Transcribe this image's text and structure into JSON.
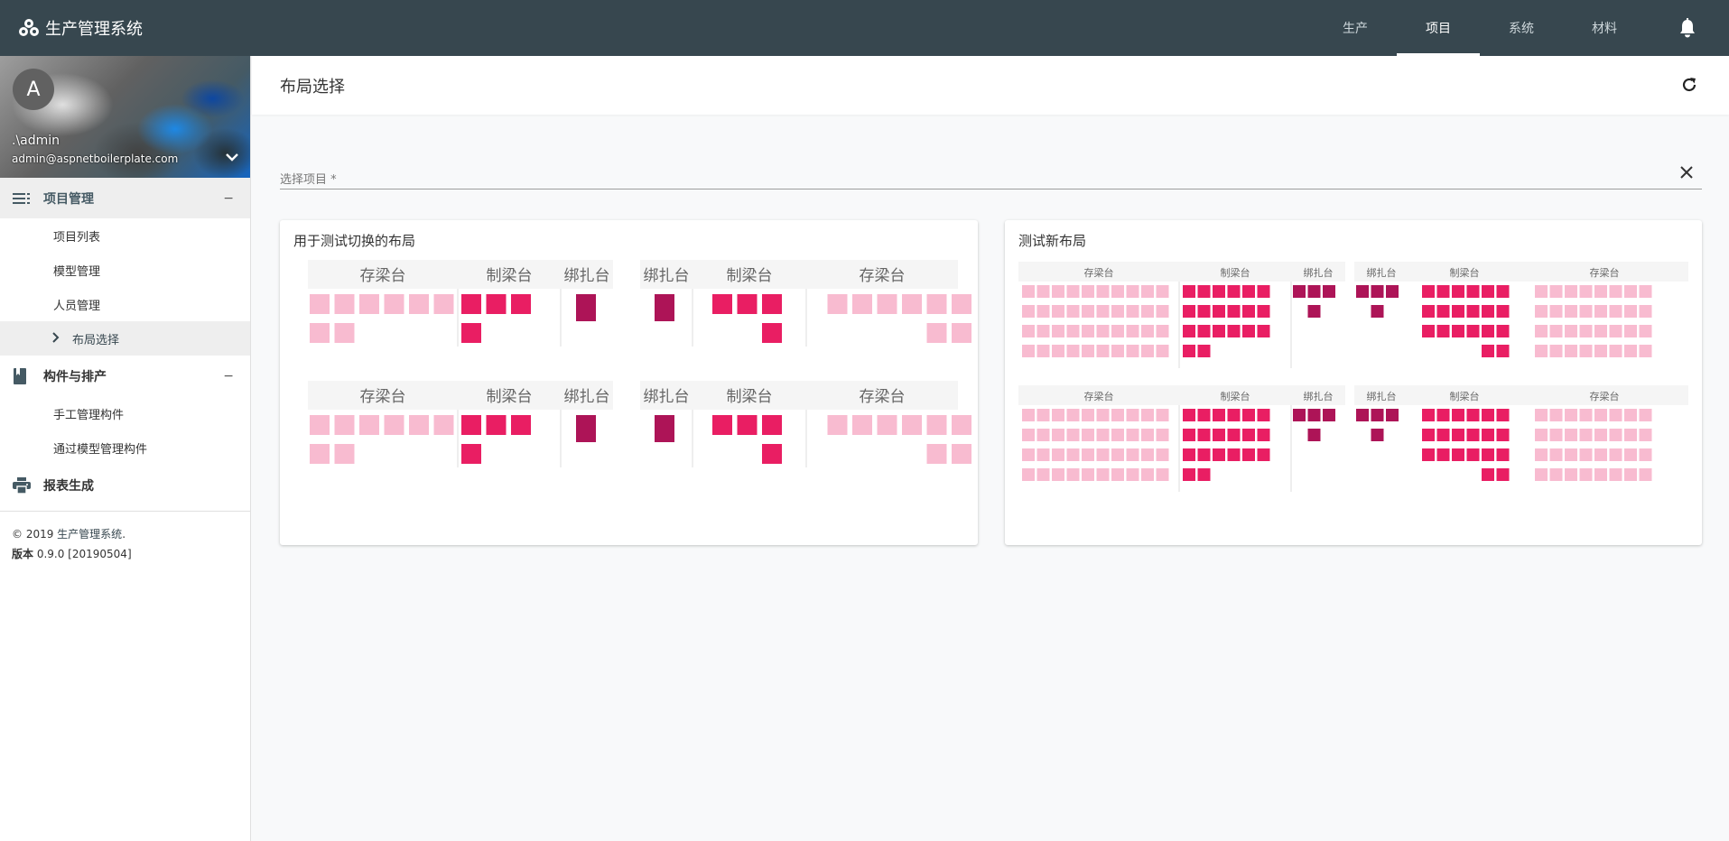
{
  "app": {
    "title": "生产管理系统"
  },
  "topnav": [
    {
      "label": "生产",
      "active": false
    },
    {
      "label": "项目",
      "active": true
    },
    {
      "label": "系统",
      "active": false
    },
    {
      "label": "材料",
      "active": false
    }
  ],
  "user": {
    "initial": "A",
    "name": ".\\admin",
    "email": "admin@aspnetboilerplate.com"
  },
  "sidebar": {
    "groups": [
      {
        "label": "项目管理",
        "icon": "list-icon",
        "expanded": true,
        "items": [
          {
            "label": "项目列表",
            "active": false
          },
          {
            "label": "模型管理",
            "active": false
          },
          {
            "label": "人员管理",
            "active": false
          },
          {
            "label": "布局选择",
            "active": true
          }
        ]
      },
      {
        "label": "构件与排产",
        "icon": "book-icon",
        "expanded": true,
        "items": [
          {
            "label": "手工管理构件",
            "active": false
          },
          {
            "label": "通过模型管理构件",
            "active": false
          }
        ]
      },
      {
        "label": "报表生成",
        "icon": "printer-icon"
      }
    ],
    "collapse_symbol": "−"
  },
  "footer": {
    "copyright": "© 2019 ",
    "app_link": "生产管理系统",
    "period": ".",
    "version_label": "版本",
    "version": " 0.9.0 [20190504]"
  },
  "page": {
    "title": "布局选择"
  },
  "select": {
    "label": "选择项目 *"
  },
  "colors": {
    "topbar": "#37474f",
    "light_pink": "#f8bbd0",
    "pink": "#e91e63",
    "dark_pink": "#ad1457"
  },
  "cards": [
    {
      "title": "用于测试切换的布局",
      "headers": [
        "存梁台",
        "制梁台",
        "绑扎台",
        "绑扎台",
        "制梁台",
        "存梁台"
      ]
    },
    {
      "title": "测试新布局",
      "headers": [
        "存梁台",
        "制梁台",
        "绑扎台",
        "绑扎台",
        "制梁台",
        "存梁台"
      ]
    }
  ]
}
